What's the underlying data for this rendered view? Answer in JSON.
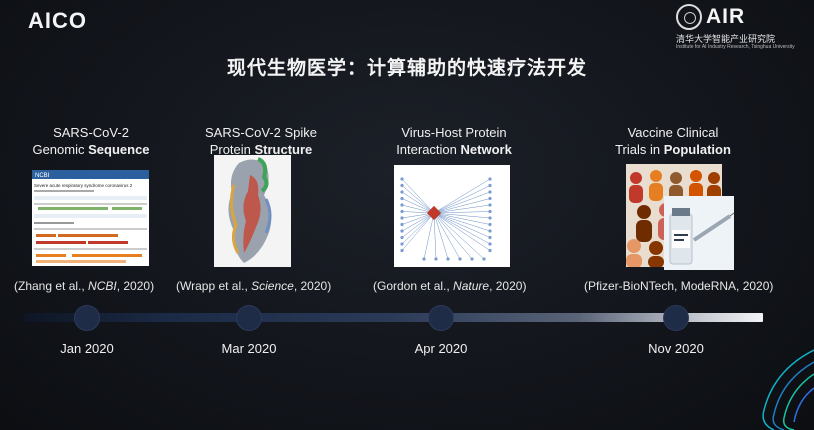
{
  "header": {
    "logo_left": "AICO",
    "logo_right_main": "AIR",
    "logo_right_sub": "清华大学智能产业研究院",
    "logo_right_en": "Institute for AI Industry Research, Tsinghua University"
  },
  "title": "现代生物医学：计算辅助的快速疗法开发",
  "columns": [
    {
      "line1": "SARS-CoV-2",
      "line2_pre": "Genomic ",
      "line2_bold": "Sequence",
      "cite_pre": "(Zhang et al., ",
      "cite_italic": "NCBI",
      "cite_post": ", 2020)",
      "date": "Jan 2020",
      "thumb_title": "Severe acute respiratory syndrome coronavirus 2",
      "thumb_brand": "NCBI"
    },
    {
      "line1": "SARS-CoV-2 Spike",
      "line2_pre": "Protein ",
      "line2_bold": "Structure",
      "cite_pre": "(Wrapp et al., ",
      "cite_italic": "Science",
      "cite_post": ", 2020)",
      "date": "Mar 2020"
    },
    {
      "line1": "Virus-Host Protein",
      "line2_pre": "Interaction ",
      "line2_bold": "Network",
      "cite_pre": "(Gordon et al., ",
      "cite_italic": "Nature",
      "cite_post": ", 2020)",
      "date": "Apr 2020"
    },
    {
      "line1": "Vaccine Clinical",
      "line2_pre": "Trials in ",
      "line2_bold": "Population",
      "cite_pre": "(Pfizer-BioNTech, ModeRNA, 2020)",
      "cite_italic": "",
      "cite_post": "",
      "date": "Nov 2020"
    }
  ],
  "colors": {
    "accent_dot": "#1e2c48",
    "bg": "#12151b"
  }
}
